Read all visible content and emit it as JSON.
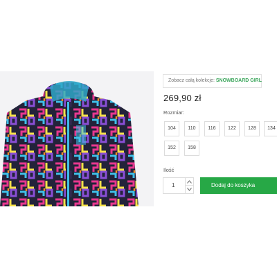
{
  "collection": {
    "prefix": "Zobacz całą kolekcje:",
    "link": "SNOWBOARD GIRL"
  },
  "product": {
    "price": "269,90 zł"
  },
  "sizes": {
    "label": "Rozmiar:",
    "options": [
      "104",
      "110",
      "116",
      "122",
      "128",
      "134",
      "152",
      "158"
    ]
  },
  "quantity": {
    "label": "Ilość",
    "value": "1"
  },
  "cart": {
    "add_label": "Dodaj do koszyka"
  },
  "colors": {
    "accent": "#27a846",
    "link": "#3aa55a"
  },
  "icons": {
    "qty_up": "chevron-up-icon",
    "qty_down": "chevron-down-icon"
  }
}
